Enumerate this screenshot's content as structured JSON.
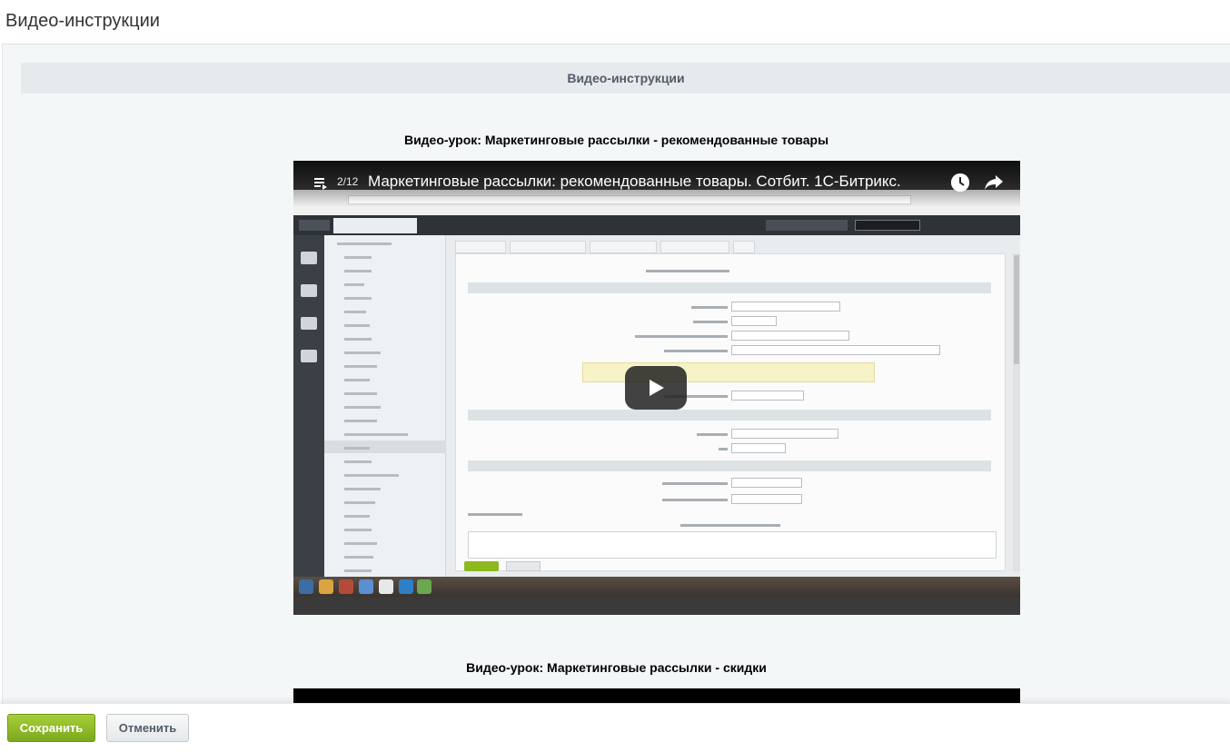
{
  "page": {
    "title": "Видео-инструкции"
  },
  "section": {
    "header": "Видео-инструкции"
  },
  "lessons": [
    {
      "title": "Видео-урок: Маркетинговые рассылки - рекомендованные товары",
      "video": {
        "playlist_position": "2/12",
        "title": "Маркетинговые рассылки: рекомендованные товары. Сотбит. 1С-Битрикс."
      }
    },
    {
      "title": "Видео-урок: Маркетинговые рассылки - скидки"
    }
  ],
  "footer": {
    "save_label": "Сохранить",
    "cancel_label": "Отменить"
  },
  "icons": {
    "playlist": "playlist-icon",
    "watch_later": "clock-icon",
    "share": "share-icon",
    "play": "play-icon"
  },
  "colors": {
    "save_button": "#8ab72a",
    "header_bg": "#e6eaec",
    "content_bg": "#f4f7f8"
  }
}
